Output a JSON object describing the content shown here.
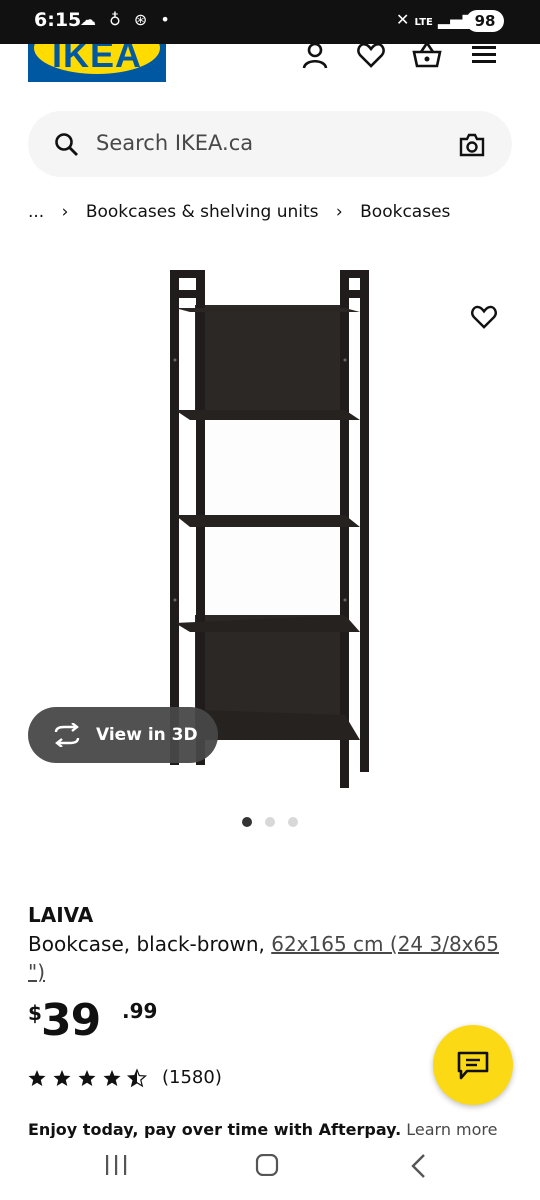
{
  "status_bar": {
    "time": "6:15",
    "battery": "98",
    "network": "LTE"
  },
  "header": {
    "logo_text": "IKEA"
  },
  "search": {
    "placeholder": "Search IKEA.ca"
  },
  "breadcrumb": {
    "items": [
      "...",
      "Bookcases & shelving units",
      "Bookcases"
    ],
    "separator": "›"
  },
  "product": {
    "name": "LAIVA",
    "description": "Bookcase, black-brown, ",
    "dimensions": "62x165 cm (24 3/8x65 \")",
    "price": {
      "currency": "$",
      "whole": "39",
      "cents": ".99"
    },
    "rating": 4.5,
    "reviews": "(1580)",
    "view_3d_label": "View in 3D",
    "image_count": 3,
    "active_image": 1
  },
  "afterpay": {
    "text": "Enjoy today, pay over time with Afterpay.",
    "link": "Learn more"
  },
  "colors": {
    "ikea_blue": "#0058a3",
    "ikea_yellow": "#ffdb00",
    "chat_yellow": "#fbd914",
    "dark_pill": "#484848"
  },
  "icons": [
    "profile-icon",
    "heart-icon",
    "cart-icon",
    "menu-icon",
    "search-icon",
    "camera-icon",
    "chat-icon",
    "rotate-3d-icon"
  ]
}
